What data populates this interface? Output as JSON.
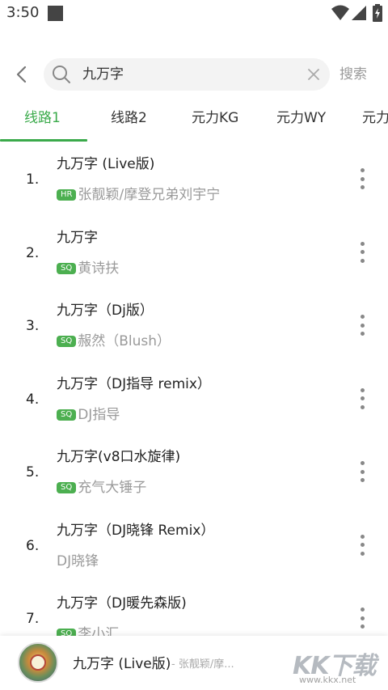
{
  "status_bar": {
    "time": "3:50"
  },
  "search": {
    "query": "九万字",
    "action_label": "搜索"
  },
  "tabs": [
    {
      "label": "线路1",
      "active": true
    },
    {
      "label": "线路2",
      "active": false
    },
    {
      "label": "元力KG",
      "active": false
    },
    {
      "label": "元力WY",
      "active": false
    },
    {
      "label": "元力",
      "active": false
    }
  ],
  "songs": [
    {
      "index": "1.",
      "title": "九万字 (Live版)",
      "badge": "HR",
      "artist": "张靓颖/摩登兄弟刘宇宁"
    },
    {
      "index": "2.",
      "title": "九万字",
      "badge": "SQ",
      "artist": "黄诗扶"
    },
    {
      "index": "3.",
      "title": "九万字（Dj版）",
      "badge": "SQ",
      "artist": "赧然（Blush）"
    },
    {
      "index": "4.",
      "title": "九万字（DJ指导 remix）",
      "badge": "SQ",
      "artist": "DJ指导"
    },
    {
      "index": "5.",
      "title": "九万字(v8口水旋律)",
      "badge": "SQ",
      "artist": "充气大锤子"
    },
    {
      "index": "6.",
      "title": "九万字（DJ晓锋 Remix）",
      "badge": "",
      "artist": "DJ晓锋"
    },
    {
      "index": "7.",
      "title": "九万字（DJ暖先森版)",
      "badge": "SQ",
      "artist": "李小汇"
    }
  ],
  "player": {
    "title": "九万字 (Live版)",
    "artist": "- 张靓颖/摩..."
  },
  "watermark": {
    "brand": "KK下载",
    "url": "www.kkx.net"
  },
  "colors": {
    "accent": "#3aaa4a",
    "badge": "#4caf50",
    "muted_text": "#9a9a9a"
  }
}
